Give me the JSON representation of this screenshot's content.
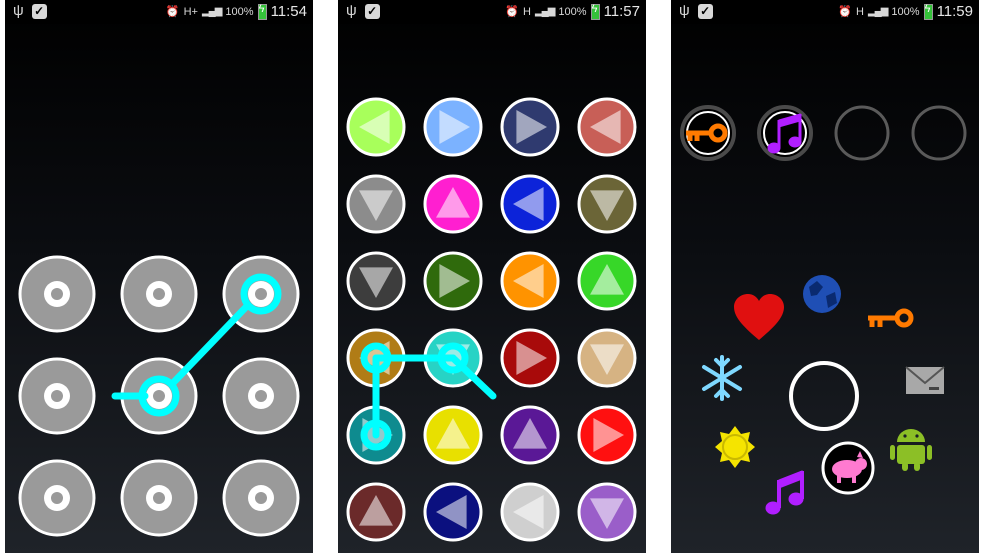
{
  "screens": [
    {
      "status": {
        "network": "H+",
        "battery": "100%",
        "time": "11:54"
      },
      "app": "pattern-lock",
      "grid": {
        "rows": 3,
        "cols": 3
      },
      "dot_color": "#999999",
      "path_color": "#00ffff",
      "path_nodes": [
        [
          1,
          1
        ],
        [
          0,
          2
        ]
      ]
    },
    {
      "status": {
        "network": "H",
        "battery": "100%",
        "time": "11:57"
      },
      "app": "color-triangle-lock",
      "grid": {
        "rows": 6,
        "cols": 4
      },
      "tiles": [
        {
          "color": "#a8ff5b",
          "dir": "left"
        },
        {
          "color": "#7bb2ff",
          "dir": "right"
        },
        {
          "color": "#2f3a6f",
          "dir": "right"
        },
        {
          "color": "#c85f57",
          "dir": "left"
        },
        {
          "color": "#8c8c8c",
          "dir": "down"
        },
        {
          "color": "#ff1fd0",
          "dir": "up"
        },
        {
          "color": "#0c23d9",
          "dir": "left"
        },
        {
          "color": "#6b6537",
          "dir": "down"
        },
        {
          "color": "#3d3d3d",
          "dir": "down"
        },
        {
          "color": "#2f6a0c",
          "dir": "right"
        },
        {
          "color": "#ff9300",
          "dir": "left"
        },
        {
          "color": "#37d728",
          "dir": "up"
        },
        {
          "color": "#b07c16",
          "dir": "left"
        },
        {
          "color": "#27d3c5",
          "dir": "down"
        },
        {
          "color": "#a80a0a",
          "dir": "right"
        },
        {
          "color": "#d6b383",
          "dir": "down"
        },
        {
          "color": "#0e8b8f",
          "dir": "right"
        },
        {
          "color": "#e8e000",
          "dir": "up"
        },
        {
          "color": "#5a1896",
          "dir": "up"
        },
        {
          "color": "#ff1010",
          "dir": "right"
        },
        {
          "color": "#6b2a2a",
          "dir": "up"
        },
        {
          "color": "#0b107f",
          "dir": "left"
        },
        {
          "color": "#cfcfcf",
          "dir": "left"
        },
        {
          "color": "#9a5ec9",
          "dir": "down"
        }
      ],
      "path_color": "#00ffff"
    },
    {
      "status": {
        "network": "H",
        "battery": "100%",
        "time": "11:59"
      },
      "app": "icon-lock",
      "slots": [
        {
          "icon": "key-icon",
          "color": "#ff7a00"
        },
        {
          "icon": "music-note-icon",
          "color": "#b11fff"
        },
        {
          "icon": "empty"
        },
        {
          "icon": "empty"
        }
      ],
      "ring_icons": [
        {
          "icon": "heart-icon",
          "color": "#e01010"
        },
        {
          "icon": "globe-icon",
          "color": "#1f4fb5"
        },
        {
          "icon": "key-icon",
          "color": "#ff7a00"
        },
        {
          "icon": "snowflake-icon",
          "color": "#7fd8ff"
        },
        {
          "icon": "envelope-icon",
          "color": "#a8a8a8"
        },
        {
          "icon": "sun-icon",
          "color": "#f5e400"
        },
        {
          "icon": "android-icon",
          "color": "#8cbf26"
        },
        {
          "icon": "music-note-icon",
          "color": "#b11fff"
        },
        {
          "icon": "pig-icon",
          "color": "#ff7ad0"
        }
      ]
    }
  ]
}
